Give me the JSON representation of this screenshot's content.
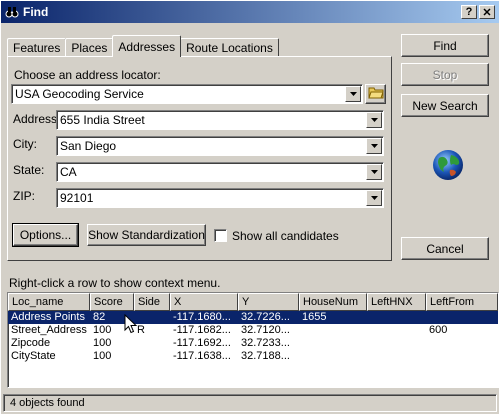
{
  "window": {
    "title": "Find",
    "help_btn": "?",
    "close_btn": "X"
  },
  "tabs": [
    {
      "label": "Features"
    },
    {
      "label": "Places"
    },
    {
      "label": "Addresses",
      "active": true
    },
    {
      "label": "Route Locations"
    }
  ],
  "locator": {
    "label": "Choose an address locator:",
    "value": "USA Geocoding Service"
  },
  "fields": {
    "address_label": "Address:",
    "address_value": "655 India Street",
    "city_label": "City:",
    "city_value": "San Diego",
    "state_label": "State:",
    "state_value": "CA",
    "zip_label": "ZIP:",
    "zip_value": "92101"
  },
  "panel_buttons": {
    "options": "Options...",
    "show_standardization": "Show Standardization",
    "show_all_candidates": "Show all candidates"
  },
  "right_buttons": {
    "find": "Find",
    "stop": "Stop",
    "new_search": "New Search",
    "cancel": "Cancel"
  },
  "hint": "Right-click a row to show context menu.",
  "grid": {
    "columns": [
      "Loc_name",
      "Score",
      "Side",
      "X",
      "Y",
      "HouseNum",
      "LeftHNX",
      "LeftFrom"
    ],
    "rows": [
      [
        "Address Points",
        "82",
        "",
        "-117.1680...",
        "32.7226...",
        "1655",
        "",
        ""
      ],
      [
        "Street_Address",
        "100",
        "R",
        "-117.1682...",
        "32.7120...",
        "",
        "",
        "600"
      ],
      [
        "Zipcode",
        "100",
        "",
        "-117.1692...",
        "32.7233...",
        "",
        "",
        ""
      ],
      [
        "CityState",
        "100",
        "",
        "-117.1638...",
        "32.7188...",
        "",
        "",
        ""
      ]
    ],
    "selected_row": 0
  },
  "status": "4 objects found",
  "colors": {
    "face": "#d4d0c8",
    "titlebar_start": "#0a246a",
    "titlebar_end": "#a6caf0",
    "selection": "#0a246a"
  }
}
